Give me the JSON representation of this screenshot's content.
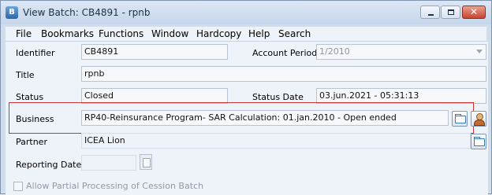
{
  "window": {
    "app_icon_letter": "B",
    "title": "View Batch: CB4891 - rpnb",
    "controls": {
      "minimize_icon": "minimize-icon",
      "maximize_icon": "maximize-icon",
      "close_glyph": "✕"
    }
  },
  "menu": [
    "File",
    "Bookmarks",
    "Functions",
    "Window",
    "Hardcopy",
    "Help",
    "Search"
  ],
  "fields": {
    "identifier": {
      "label": "Identifier",
      "value": "CB4891"
    },
    "account_period": {
      "label": "Account Period",
      "value": "1/2010"
    },
    "title": {
      "label": "Title",
      "value": "rpnb"
    },
    "status": {
      "label": "Status",
      "value": "Closed"
    },
    "status_date": {
      "label": "Status Date",
      "value": "03.jun.2021 - 05:31:13"
    },
    "business": {
      "label": "Business",
      "value": "RP40-Reinsurance Program- SAR Calculation: 01.jan.2010  - Open ended"
    },
    "partner": {
      "label": "Partner",
      "value": "ICEA Lion"
    },
    "reporting_date": {
      "label": "Reporting Date",
      "value": ""
    }
  },
  "checkbox": {
    "label": "Allow Partial Processing of Cession Batch",
    "checked": false
  },
  "colors": {
    "highlight": "#c43737",
    "background": "#eef3f9"
  }
}
